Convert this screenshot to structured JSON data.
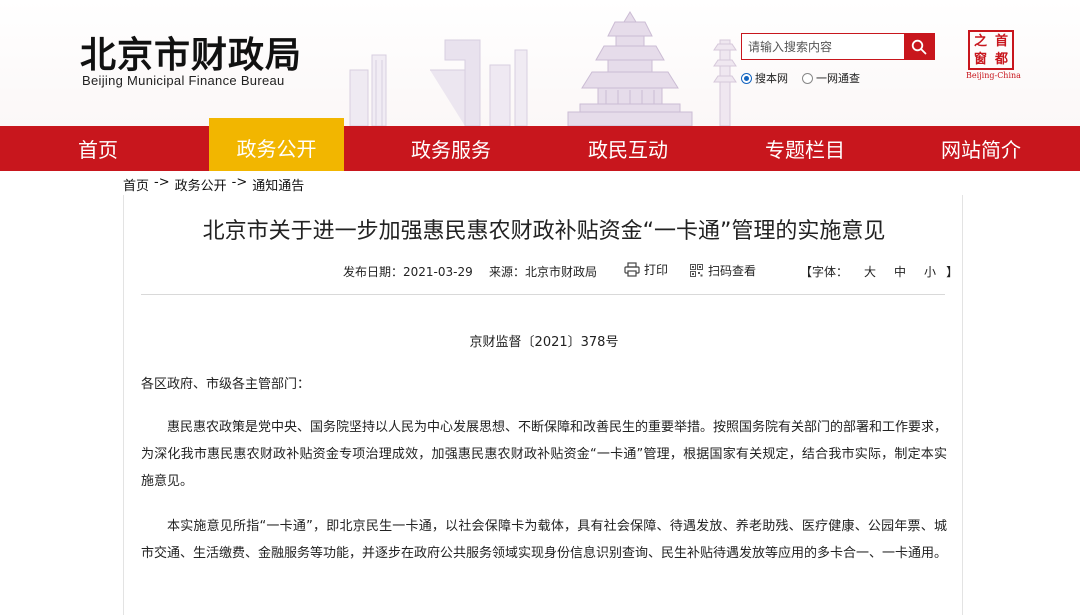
{
  "header": {
    "logo_cn": "北京市财政局",
    "logo_en": "Beijing Municipal Finance Bureau",
    "search": {
      "placeholder": "请输入搜索内容"
    },
    "scope": {
      "option_site": "搜本网",
      "option_all": "一网通查",
      "selected": "搜本网"
    },
    "seal": {
      "chars": [
        "之",
        "首",
        "窗",
        "都"
      ],
      "caption": "Beijing-China"
    }
  },
  "nav": {
    "items": [
      "首页",
      "政务公开",
      "政务服务",
      "政民互动",
      "专题栏目",
      "网站简介"
    ],
    "active": "政务公开"
  },
  "breadcrumb": {
    "items": [
      "首页",
      "政务公开",
      "通知通告"
    ],
    "separator": "->"
  },
  "article": {
    "title": "北京市关于进一步加强惠民惠农财政补贴资金“一卡通”管理的实施意见",
    "meta": {
      "date_label": "发布日期：",
      "date": "2021-03-29",
      "source_label": "来源：",
      "source": "北京市财政局",
      "print_label": "打印",
      "qr_label": "扫码查看",
      "font_label_open": "【字体：",
      "font_large": "大",
      "font_medium": "中",
      "font_small": "小",
      "font_label_close": "】"
    },
    "doc_number": "京财监督〔2021〕378号",
    "salutation": "各区政府、市级各主管部门：",
    "paragraphs": [
      "惠民惠农政策是党中央、国务院坚持以人民为中心发展思想、不断保障和改善民生的重要举措。按照国务院有关部门的部署和工作要求，为深化我市惠民惠农财政补贴资金专项治理成效，加强惠民惠农财政补贴资金“一卡通”管理，根据国家有关规定，结合我市实际，制定本实施意见。",
      "本实施意见所指“一卡通”，即北京民生一卡通，以社会保障卡为载体，具有社会保障、待遇发放、养老助残、医疗健康、公园年票、城市交通、生活缴费、金融服务等功能，并逐步在政府公共服务领域实现身份信息识别查询、民生补贴待遇发放等应用的多卡合一、一卡通用。"
    ]
  },
  "colors": {
    "brand_red": "#c8161d",
    "active_gold": "#f2b600"
  }
}
